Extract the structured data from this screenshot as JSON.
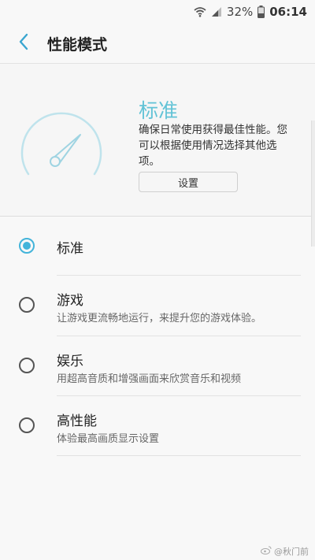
{
  "status_bar": {
    "battery_percent": "32%",
    "time": "06:14",
    "icons": [
      "wifi-icon",
      "signal-icon",
      "battery-icon"
    ]
  },
  "app_bar": {
    "title": "性能模式",
    "back_icon": "chevron-left-icon"
  },
  "hero": {
    "mode_title": "标准",
    "description": "确保日常使用获得最佳性能。您可以根据使用情况选择其他选项。",
    "settings_button": "设置",
    "gauge_icon": "speedometer-icon"
  },
  "options": [
    {
      "label": "标准",
      "subtitle": "",
      "checked": true
    },
    {
      "label": "游戏",
      "subtitle": "让游戏更流畅地运行，来提升您的游戏体验。",
      "checked": false
    },
    {
      "label": "娱乐",
      "subtitle": "用超高音质和增强画面来欣赏音乐和视频",
      "checked": false
    },
    {
      "label": "高性能",
      "subtitle": "体验最高画质显示设置",
      "checked": false
    }
  ],
  "watermark": "@秋门前",
  "colors": {
    "accent": "#43b4da",
    "mode_title": "#62c3d6",
    "background": "#f8f8f8"
  }
}
